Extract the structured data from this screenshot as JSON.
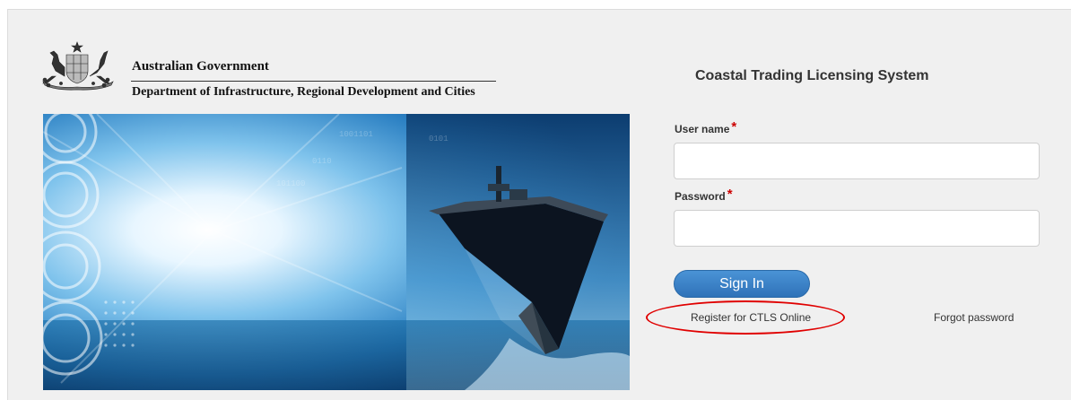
{
  "header": {
    "gov_name": "Australian Government",
    "department": "Department of Infrastructure, Regional Development and Cities"
  },
  "login": {
    "system_title": "Coastal Trading Licensing System",
    "username_label": "User name",
    "password_label": "Password",
    "required_marker": "*",
    "username_value": "",
    "password_value": "",
    "signin_label": "Sign In",
    "register_link": "Register for CTLS Online",
    "forgot_link": "Forgot password"
  },
  "icons": {
    "crest": "australian-coat-of-arms-icon"
  },
  "colors": {
    "button": "#3a83c9",
    "required": "#cc0000",
    "highlight_circle": "#e00000"
  }
}
